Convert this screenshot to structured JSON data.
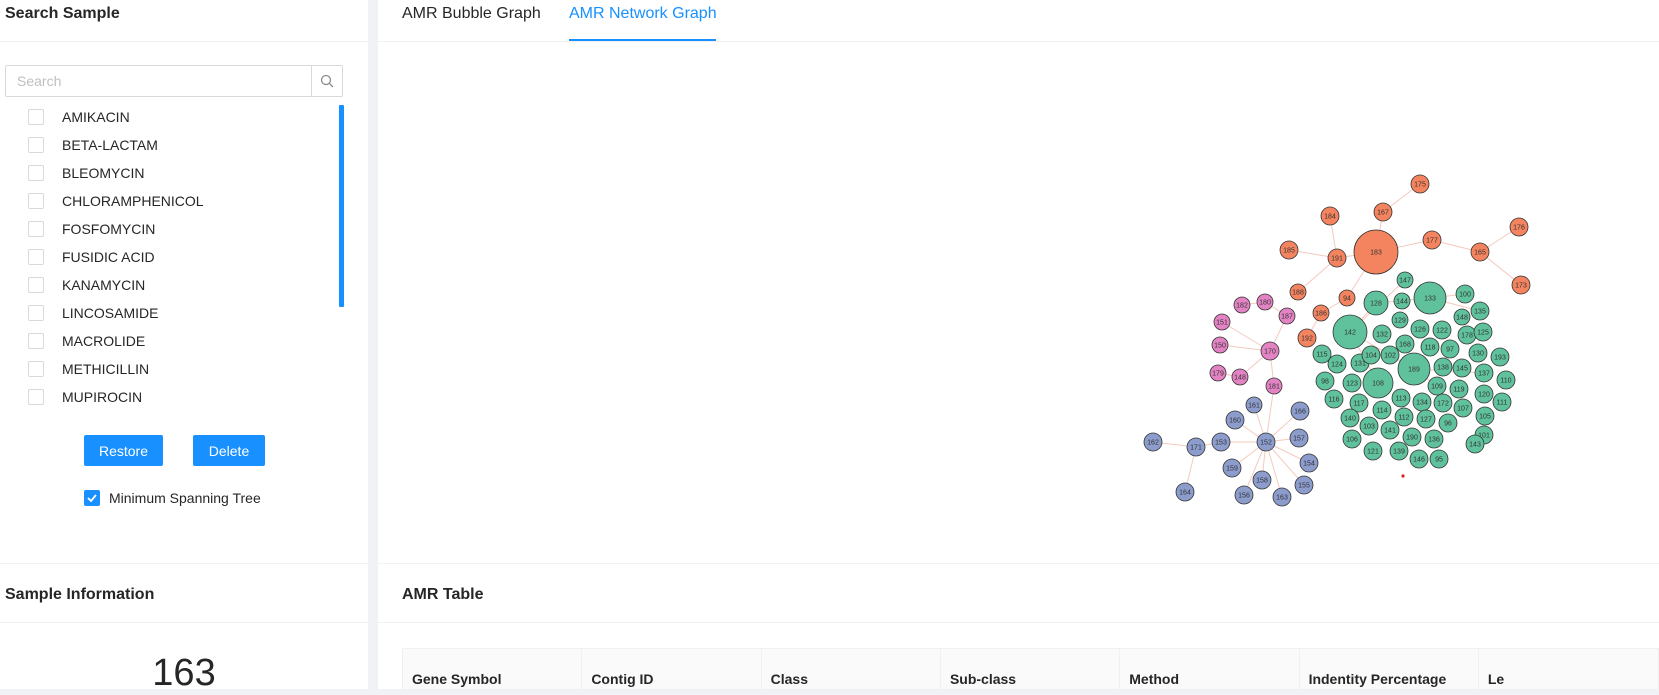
{
  "sidebar": {
    "title": "Search Sample",
    "search_placeholder": "Search",
    "items": [
      "AMIKACIN",
      "BETA-LACTAM",
      "BLEOMYCIN",
      "CHLORAMPHENICOL",
      "FOSFOMYCIN",
      "FUSIDIC ACID",
      "KANAMYCIN",
      "LINCOSAMIDE",
      "MACROLIDE",
      "METHICILLIN",
      "MUPIROCIN"
    ],
    "restore_label": "Restore",
    "delete_label": "Delete",
    "mst_label": "Minimum Spanning Tree",
    "mst_checked": true
  },
  "tabs": [
    {
      "label": "AMR Bubble Graph",
      "active": false
    },
    {
      "label": "AMR Network Graph",
      "active": true
    }
  ],
  "sample_info": {
    "title": "Sample Information",
    "value": "163"
  },
  "amr_table": {
    "title": "AMR Table",
    "columns": [
      "Gene Symbol",
      "Contig ID",
      "Class",
      "Sub-class",
      "Method",
      "Indentity Percentage",
      "Le"
    ]
  },
  "colors": {
    "accent": "#1890ff",
    "orange": "#f4845f",
    "pink": "#e383c4",
    "blue": "#8c9ccc",
    "green": "#5fc29c"
  },
  "graph": {
    "nodes": [
      {
        "id": "175",
        "c": "orange"
      },
      {
        "id": "184",
        "c": "orange"
      },
      {
        "id": "167",
        "c": "orange"
      },
      {
        "id": "176",
        "c": "orange"
      },
      {
        "id": "185",
        "c": "orange"
      },
      {
        "id": "191",
        "c": "orange"
      },
      {
        "id": "183",
        "c": "orange"
      },
      {
        "id": "177",
        "c": "orange"
      },
      {
        "id": "165",
        "c": "orange"
      },
      {
        "id": "173",
        "c": "orange"
      },
      {
        "id": "188",
        "c": "orange"
      },
      {
        "id": "94",
        "c": "orange"
      },
      {
        "id": "186",
        "c": "orange"
      },
      {
        "id": "192",
        "c": "orange"
      },
      {
        "id": "182",
        "c": "pink"
      },
      {
        "id": "180",
        "c": "pink"
      },
      {
        "id": "187",
        "c": "pink"
      },
      {
        "id": "151",
        "c": "pink"
      },
      {
        "id": "150",
        "c": "pink"
      },
      {
        "id": "170",
        "c": "pink"
      },
      {
        "id": "179",
        "c": "pink"
      },
      {
        "id": "148",
        "c": "pink"
      },
      {
        "id": "181",
        "c": "pink"
      },
      {
        "id": "161",
        "c": "blue"
      },
      {
        "id": "166",
        "c": "blue"
      },
      {
        "id": "160",
        "c": "blue"
      },
      {
        "id": "162",
        "c": "blue"
      },
      {
        "id": "171",
        "c": "blue"
      },
      {
        "id": "153",
        "c": "blue"
      },
      {
        "id": "152",
        "c": "blue"
      },
      {
        "id": "157",
        "c": "blue"
      },
      {
        "id": "159",
        "c": "blue"
      },
      {
        "id": "154",
        "c": "blue"
      },
      {
        "id": "158",
        "c": "blue"
      },
      {
        "id": "164",
        "c": "blue"
      },
      {
        "id": "156",
        "c": "blue"
      },
      {
        "id": "163",
        "c": "blue"
      },
      {
        "id": "155",
        "c": "blue"
      },
      {
        "id": "147",
        "c": "green"
      },
      {
        "id": "133",
        "c": "green"
      },
      {
        "id": "100",
        "c": "green"
      },
      {
        "id": "128",
        "c": "green"
      },
      {
        "id": "144",
        "c": "green"
      },
      {
        "id": "135",
        "c": "green"
      },
      {
        "id": "142",
        "c": "green"
      },
      {
        "id": "129",
        "c": "green"
      },
      {
        "id": "148",
        "c": "green"
      },
      {
        "id": "132",
        "c": "green"
      },
      {
        "id": "126",
        "c": "green"
      },
      {
        "id": "122",
        "c": "green"
      },
      {
        "id": "178",
        "c": "green"
      },
      {
        "id": "125",
        "c": "green"
      },
      {
        "id": "168",
        "c": "green"
      },
      {
        "id": "118",
        "c": "green"
      },
      {
        "id": "97",
        "c": "green"
      },
      {
        "id": "130",
        "c": "green"
      },
      {
        "id": "193",
        "c": "green"
      },
      {
        "id": "115",
        "c": "green"
      },
      {
        "id": "124",
        "c": "green"
      },
      {
        "id": "131",
        "c": "green"
      },
      {
        "id": "104",
        "c": "green"
      },
      {
        "id": "102",
        "c": "green"
      },
      {
        "id": "189",
        "c": "green"
      },
      {
        "id": "138",
        "c": "green"
      },
      {
        "id": "145",
        "c": "green"
      },
      {
        "id": "137",
        "c": "green"
      },
      {
        "id": "98",
        "c": "green"
      },
      {
        "id": "123",
        "c": "green"
      },
      {
        "id": "108",
        "c": "green"
      },
      {
        "id": "109",
        "c": "green"
      },
      {
        "id": "119",
        "c": "green"
      },
      {
        "id": "110",
        "c": "green"
      },
      {
        "id": "120",
        "c": "green"
      },
      {
        "id": "116",
        "c": "green"
      },
      {
        "id": "117",
        "c": "green"
      },
      {
        "id": "113",
        "c": "green"
      },
      {
        "id": "134",
        "c": "green"
      },
      {
        "id": "172",
        "c": "green"
      },
      {
        "id": "111",
        "c": "green"
      },
      {
        "id": "114",
        "c": "green"
      },
      {
        "id": "107",
        "c": "green"
      },
      {
        "id": "140",
        "c": "green"
      },
      {
        "id": "112",
        "c": "green"
      },
      {
        "id": "127",
        "c": "green"
      },
      {
        "id": "105",
        "c": "green"
      },
      {
        "id": "103",
        "c": "green"
      },
      {
        "id": "141",
        "c": "green"
      },
      {
        "id": "96",
        "c": "green"
      },
      {
        "id": "106",
        "c": "green"
      },
      {
        "id": "190",
        "c": "green"
      },
      {
        "id": "136",
        "c": "green"
      },
      {
        "id": "101",
        "c": "green"
      },
      {
        "id": "143",
        "c": "green"
      },
      {
        "id": "121",
        "c": "green"
      },
      {
        "id": "139",
        "c": "green"
      },
      {
        "id": "146",
        "c": "green"
      },
      {
        "id": "95",
        "c": "green"
      }
    ]
  }
}
